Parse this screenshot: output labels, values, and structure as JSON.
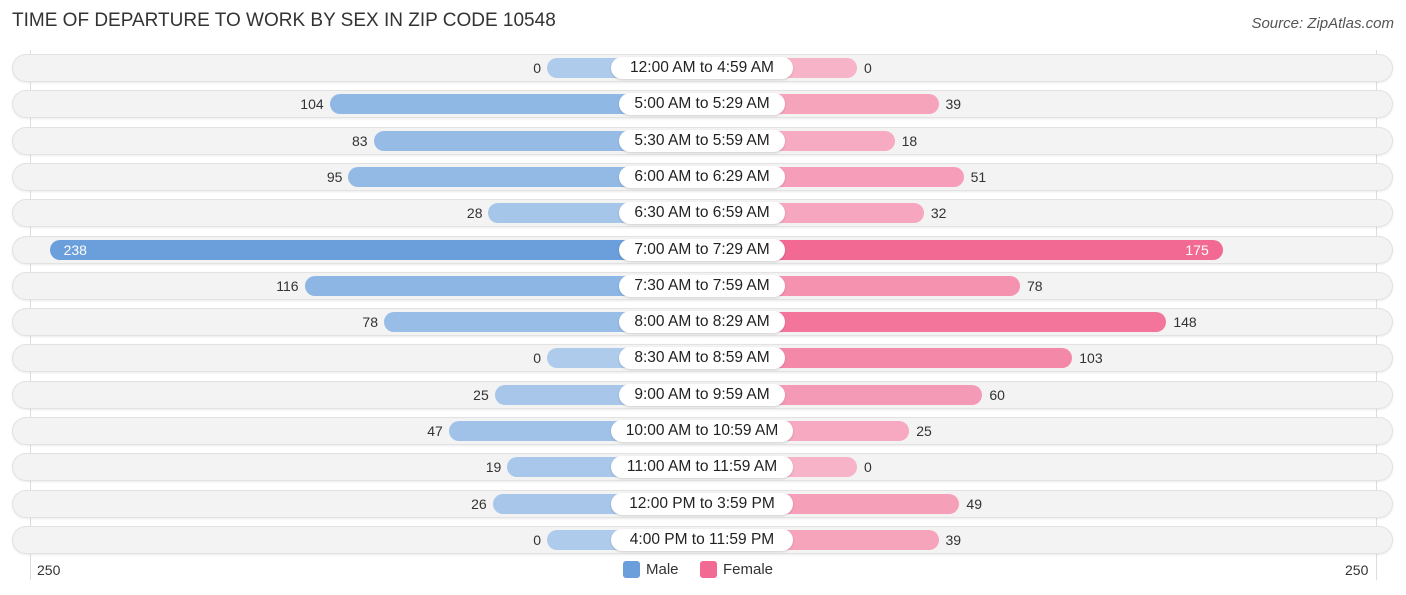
{
  "chart_data": {
    "type": "bar",
    "orientation": "horizontal-diverging",
    "title": "TIME OF DEPARTURE TO WORK BY SEX IN ZIP CODE 10548",
    "source": "Source: ZipAtlas.com",
    "categories": [
      "12:00 AM to 4:59 AM",
      "5:00 AM to 5:29 AM",
      "5:30 AM to 5:59 AM",
      "6:00 AM to 6:29 AM",
      "6:30 AM to 6:59 AM",
      "7:00 AM to 7:29 AM",
      "7:30 AM to 7:59 AM",
      "8:00 AM to 8:29 AM",
      "8:30 AM to 8:59 AM",
      "9:00 AM to 9:59 AM",
      "10:00 AM to 10:59 AM",
      "11:00 AM to 11:59 AM",
      "12:00 PM to 3:59 PM",
      "4:00 PM to 11:59 PM"
    ],
    "series": [
      {
        "name": "Male",
        "color": "#6a9fdc",
        "values": [
          0,
          104,
          83,
          95,
          28,
          238,
          116,
          78,
          0,
          25,
          47,
          19,
          26,
          0
        ]
      },
      {
        "name": "Female",
        "color": "#f26a93",
        "values": [
          0,
          39,
          18,
          51,
          32,
          175,
          78,
          148,
          103,
          60,
          25,
          0,
          49,
          39
        ]
      }
    ],
    "axis": {
      "left_label": "250",
      "right_label": "250",
      "xlim": [
        -250,
        250
      ]
    },
    "legend": {
      "position": "bottom-center",
      "items": [
        "Male",
        "Female"
      ]
    }
  }
}
